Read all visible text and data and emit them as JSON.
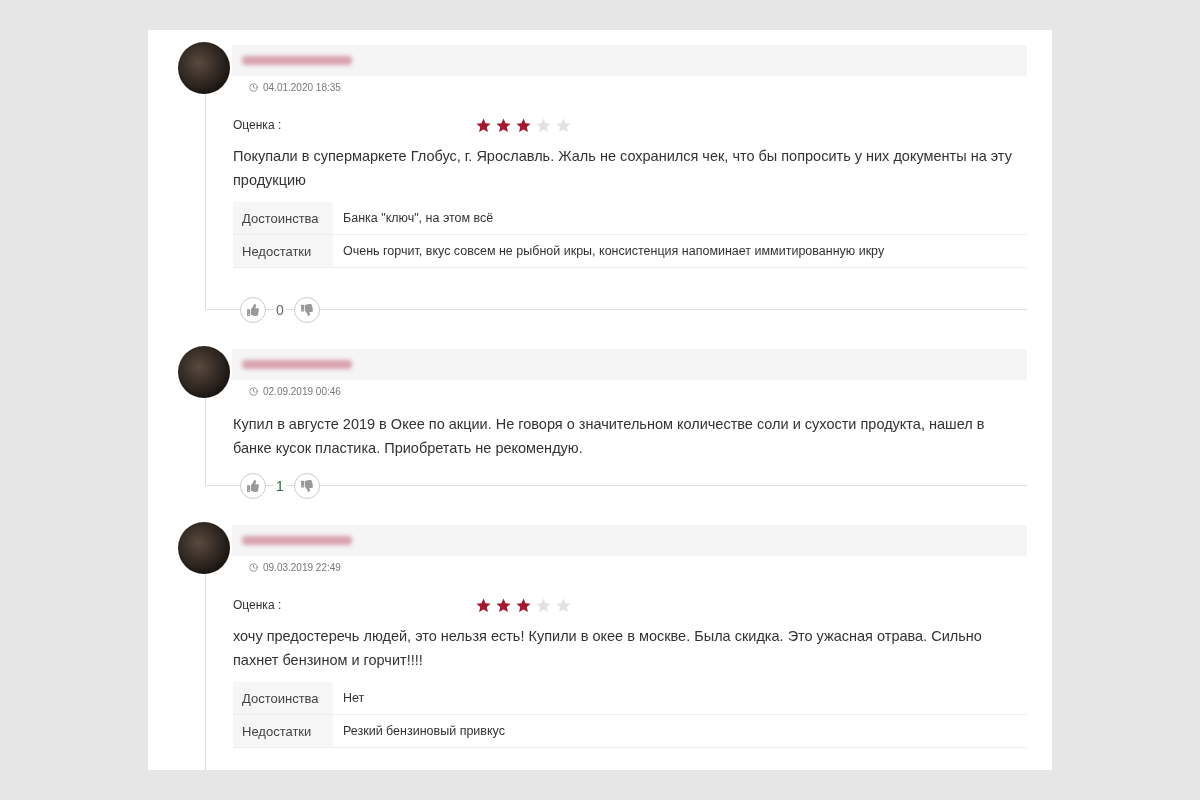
{
  "reviews": [
    {
      "date": "04.01.2020 18:35",
      "rating": {
        "label": "Оценка :",
        "stars": 3
      },
      "text": "Покупали в супермаркете Глобус, г. Ярославль. Жаль не сохранился чек, что бы попросить у них документы на эту продукцию",
      "details": [
        {
          "label": "Достоинства",
          "value": "Банка \"ключ\", на этом всё"
        },
        {
          "label": "Недостатки",
          "value": "Очень горчит, вкус совсем не рыбной икры, консистенция напоминает иммитированную икру"
        }
      ],
      "votes": {
        "count": "0",
        "color": "#666666"
      }
    },
    {
      "date": "02.09.2019 00:46",
      "text": "Купил в августе 2019 в Окее по акции. Не говоря о значительном количестве соли и сухости продукта, нашел в банке кусок пластика. Приобретать не рекомендую.",
      "votes": {
        "count": "1",
        "color": "#1e6b3c"
      }
    },
    {
      "date": "09.03.2019 22:49",
      "rating": {
        "label": "Оценка :",
        "stars": 3
      },
      "text": "хочу предостеречь людей, это нельзя есть! Купили в окее в москве. Была скидка. Это ужасная отрава. Сильно пахнет бензином и горчит!!!!",
      "details": [
        {
          "label": "Достоинства",
          "value": "Нет"
        },
        {
          "label": "Недостатки",
          "value": "Резкий бензиновый привкус"
        }
      ]
    }
  ]
}
